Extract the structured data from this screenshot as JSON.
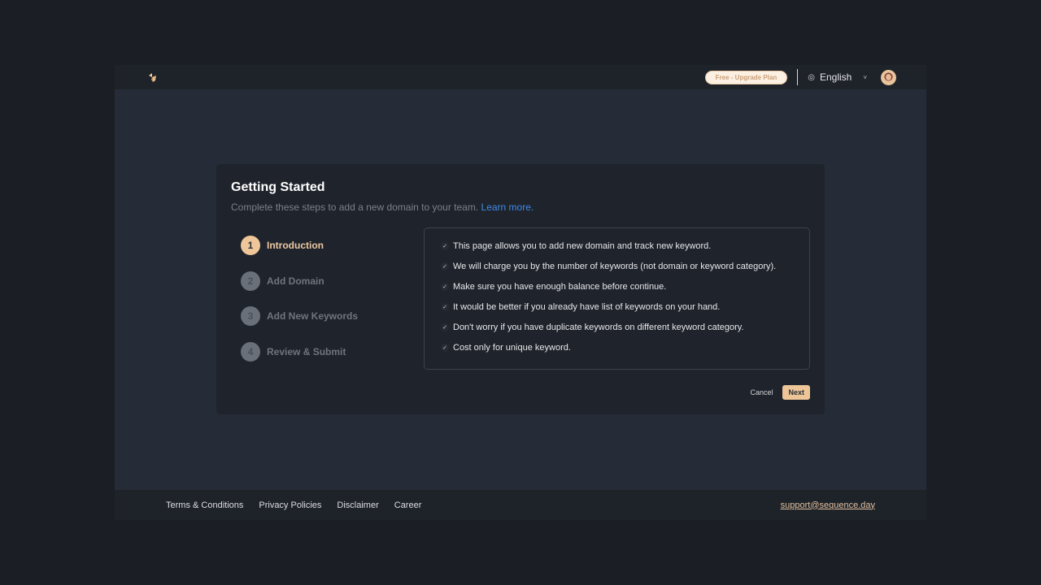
{
  "header": {
    "logo": "sequence-logo-icon",
    "plan_badge": "Free - Upgrade Plan",
    "language": "English",
    "globe_icon": "◎",
    "chevron_icon": "˅"
  },
  "card": {
    "title": "Getting Started",
    "subtitle": "Complete these steps to add a new domain to your team.",
    "learn_more": "Learn more.",
    "steps": [
      {
        "number": "1",
        "label": "Introduction",
        "active": true
      },
      {
        "number": "2",
        "label": "Add Domain",
        "active": false
      },
      {
        "number": "3",
        "label": "Add New Keywords",
        "active": false
      },
      {
        "number": "4",
        "label": "Review & Submit",
        "active": false
      }
    ],
    "info_items": [
      "This page allows you to add new domain and track new keyword.",
      "We will charge you by the number of keywords (not domain or keyword category).",
      "Make sure you have enough balance before continue.",
      "It would be better if you already have list of keywords on your hand.",
      "Don't worry if you have duplicate keywords on different keyword category.",
      "Cost only for unique keyword."
    ],
    "check_icon": "✓",
    "cancel_label": "Cancel",
    "next_label": "Next"
  },
  "footer": {
    "links": [
      "Terms & Conditions",
      "Privacy Policies",
      "Disclaimer",
      "Career"
    ],
    "support_email": "support@sequence.day"
  },
  "colors": {
    "accent": "#edc597",
    "link": "#3f8ae8",
    "background": "#1b1e24",
    "card": "#1f232b"
  }
}
